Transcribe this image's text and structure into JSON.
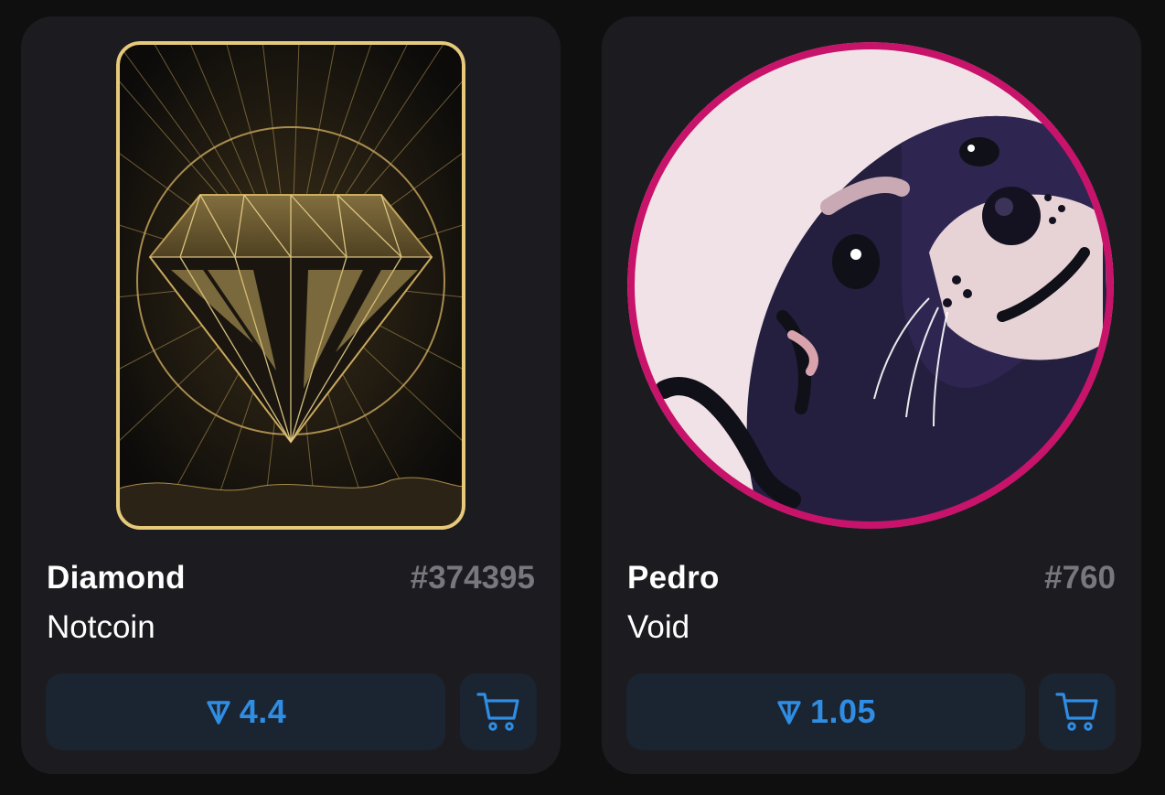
{
  "colors": {
    "background": "#0f0f10",
    "card": "#1c1c20",
    "button": "#1b2431",
    "accent": "#2f8de4",
    "number": "#77777d",
    "diamond_frame": "#e6c97a",
    "pedro_frame": "#c8136b"
  },
  "cards": [
    {
      "name": "Diamond",
      "number": "#374395",
      "collection": "Notcoin",
      "price": "4.4",
      "price_icon": "ton-icon",
      "cart_icon": "cart-icon",
      "art_icon": "diamond-card-art"
    },
    {
      "name": "Pedro",
      "number": "#760",
      "collection": "Void",
      "price": "1.05",
      "price_icon": "ton-icon",
      "cart_icon": "cart-icon",
      "art_icon": "otter-avatar-art"
    }
  ]
}
